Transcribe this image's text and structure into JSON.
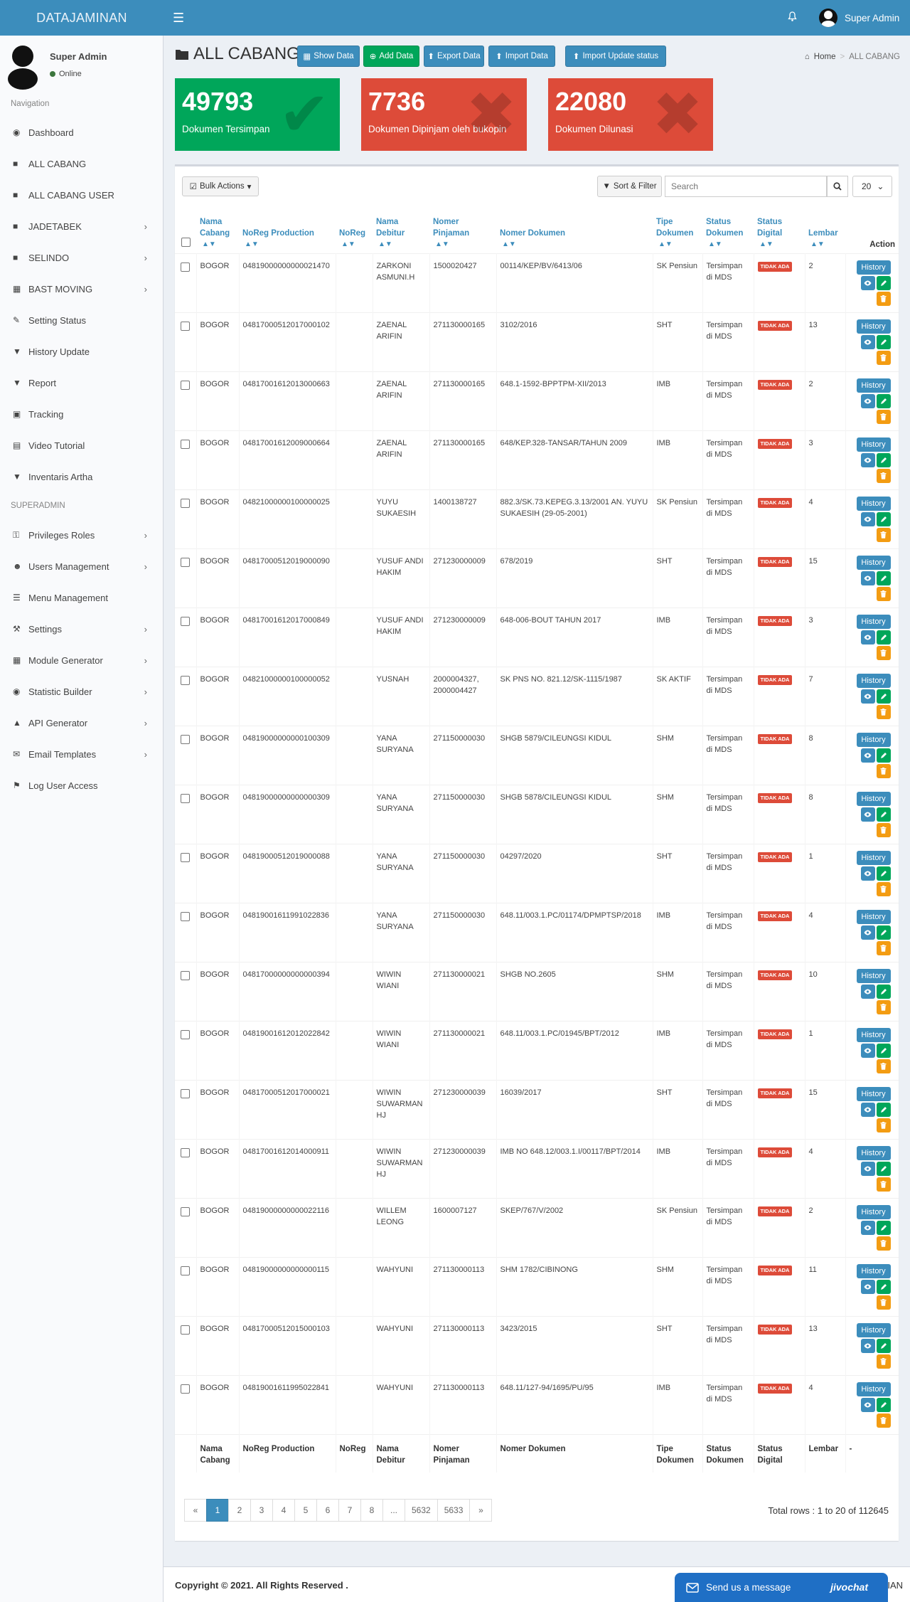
{
  "app": {
    "brand": "DATAJAMINAN",
    "top_user": "Super Admin"
  },
  "user_panel": {
    "name": "Super Admin",
    "status": "Online"
  },
  "sidebar": {
    "nav_header": "Navigation",
    "items": [
      {
        "label": "Dashboard",
        "icon": "dashboard-icon",
        "chev": false
      },
      {
        "label": "ALL CABANG",
        "icon": "folder-icon",
        "chev": false
      },
      {
        "label": "ALL CABANG USER",
        "icon": "folder-icon",
        "chev": false
      },
      {
        "label": "JADETABEK",
        "icon": "folder-icon",
        "chev": true
      },
      {
        "label": "SELINDO",
        "icon": "folder-icon",
        "chev": true
      },
      {
        "label": "BAST MOVING",
        "icon": "grid-icon",
        "chev": true
      },
      {
        "label": "Setting Status",
        "icon": "edit-icon",
        "chev": false
      },
      {
        "label": "History Update",
        "icon": "filter-icon",
        "chev": false
      },
      {
        "label": "Report",
        "icon": "filter-icon",
        "chev": false
      },
      {
        "label": "Tracking",
        "icon": "car-icon",
        "chev": false
      },
      {
        "label": "Video Tutorial",
        "icon": "file-icon",
        "chev": false
      },
      {
        "label": "Inventaris Artha",
        "icon": "filter-icon",
        "chev": false
      }
    ],
    "admin_header": "SUPERADMIN",
    "admin_items": [
      {
        "label": "Privileges Roles",
        "icon": "key-icon",
        "chev": true
      },
      {
        "label": "Users Management",
        "icon": "users-icon",
        "chev": true
      },
      {
        "label": "Menu Management",
        "icon": "menu-icon",
        "chev": false
      },
      {
        "label": "Settings",
        "icon": "wrench-icon",
        "chev": true
      },
      {
        "label": "Module Generator",
        "icon": "grid-icon",
        "chev": true
      },
      {
        "label": "Statistic Builder",
        "icon": "dashboard-icon",
        "chev": true
      },
      {
        "label": "API Generator",
        "icon": "flask-icon",
        "chev": true
      },
      {
        "label": "Email Templates",
        "icon": "envelope-icon",
        "chev": true
      },
      {
        "label": "Log User Access",
        "icon": "flag-icon",
        "chev": false
      }
    ]
  },
  "header": {
    "title": "ALL CABANG",
    "buttons": {
      "show": "Show Data",
      "add": "Add Data",
      "export": "Export Data",
      "import": "Import Data",
      "import_update": "Import Update status"
    },
    "breadcrumb": {
      "home": "Home",
      "current": "ALL CABANG"
    }
  },
  "stats": [
    {
      "value": "49793",
      "label": "Dokumen Tersimpan",
      "color": "#00a65a"
    },
    {
      "value": "7736",
      "label": "Dokumen Dipinjam oleh bukopin",
      "color": "#dd4b39"
    },
    {
      "value": "22080",
      "label": "Dokumen Dilunasi",
      "color": "#dd4b39"
    }
  ],
  "toolbar": {
    "bulk": "Bulk Actions",
    "sort": "Sort & Filter",
    "search_placeholder": "Search",
    "per_page": "20"
  },
  "table": {
    "headers": [
      "Nama Cabang",
      "NoReg Production",
      "NoReg",
      "Nama Debitur",
      "Nomer Pinjaman",
      "Nomer Dokumen",
      "Tipe Dokumen",
      "Status Dokumen",
      "Status Digital",
      "Lembar",
      "Action"
    ],
    "footer": [
      "Nama Cabang",
      "NoReg Production",
      "NoReg",
      "Nama Debitur",
      "Nomer Pinjaman",
      "Nomer Dokumen",
      "Tipe Dokumen",
      "Status Dokumen",
      "Status Digital",
      "Lembar",
      "-"
    ],
    "badge": "TIDAK ADA",
    "history_label": "History",
    "rows": [
      [
        "BOGOR",
        "04819000000000021470",
        "",
        "ZARKONI ASMUNI.H",
        "1500020427",
        "00114/KEP/BV/6413/06",
        "SK Pensiun",
        "Tersimpan di MDS",
        "2"
      ],
      [
        "BOGOR",
        "04817000512017000102",
        "",
        "ZAENAL ARIFIN",
        "271130000165",
        "3102/2016",
        "SHT",
        "Tersimpan di MDS",
        "13"
      ],
      [
        "BOGOR",
        "04817001612013000663",
        "",
        "ZAENAL ARIFIN",
        "271130000165",
        "648.1-1592-BPPTPM-XII/2013",
        "IMB",
        "Tersimpan di MDS",
        "2"
      ],
      [
        "BOGOR",
        "04817001612009000664",
        "",
        "ZAENAL ARIFIN",
        "271130000165",
        "648/KEP.328-TANSAR/TAHUN 2009",
        "IMB",
        "Tersimpan di MDS",
        "3"
      ],
      [
        "BOGOR",
        "04821000000100000025",
        "",
        "YUYU SUKAESIH",
        "1400138727",
        "882.3/SK.73.KEPEG.3.13/2001 AN. YUYU SUKAESIH (29-05-2001)",
        "SK Pensiun",
        "Tersimpan di MDS",
        "4"
      ],
      [
        "BOGOR",
        "04817000512019000090",
        "",
        "YUSUF ANDI HAKIM",
        "271230000009",
        "678/2019",
        "SHT",
        "Tersimpan di MDS",
        "15"
      ],
      [
        "BOGOR",
        "04817001612017000849",
        "",
        "YUSUF ANDI HAKIM",
        "271230000009",
        "648-006-BOUT TAHUN 2017",
        "IMB",
        "Tersimpan di MDS",
        "3"
      ],
      [
        "BOGOR",
        "04821000000100000052",
        "",
        "YUSNAH",
        "2000004327, 2000004427",
        "SK PNS NO. 821.12/SK-1115/1987",
        "SK AKTIF",
        "Tersimpan di MDS",
        "7"
      ],
      [
        "BOGOR",
        "04819000000000100309",
        "",
        "YANA SURYANA",
        "271150000030",
        "SHGB 5879/CILEUNGSI KIDUL",
        "SHM",
        "Tersimpan di MDS",
        "8"
      ],
      [
        "BOGOR",
        "04819000000000000309",
        "",
        "YANA SURYANA",
        "271150000030",
        "SHGB 5878/CILEUNGSI KIDUL",
        "SHM",
        "Tersimpan di MDS",
        "8"
      ],
      [
        "BOGOR",
        "04819000512019000088",
        "",
        "YANA SURYANA",
        "271150000030",
        "04297/2020",
        "SHT",
        "Tersimpan di MDS",
        "1"
      ],
      [
        "BOGOR",
        "04819001611991022836",
        "",
        "YANA SURYANA",
        "271150000030",
        "648.11/003.1.PC/01174/DPMPTSP/2018",
        "IMB",
        "Tersimpan di MDS",
        "4"
      ],
      [
        "BOGOR",
        "04817000000000000394",
        "",
        "WIWIN WIANI",
        "271130000021",
        "SHGB NO.2605",
        "SHM",
        "Tersimpan di MDS",
        "10"
      ],
      [
        "BOGOR",
        "04819001612012022842",
        "",
        "WIWIN WIANI",
        "271130000021",
        "648.11/003.1.PC/01945/BPT/2012",
        "IMB",
        "Tersimpan di MDS",
        "1"
      ],
      [
        "BOGOR",
        "04817000512017000021",
        "",
        "WIWIN SUWARMAN HJ",
        "271230000039",
        "16039/2017",
        "SHT",
        "Tersimpan di MDS",
        "15"
      ],
      [
        "BOGOR",
        "04817001612014000911",
        "",
        "WIWIN SUWARMAN HJ",
        "271230000039",
        "IMB NO 648.12/003.1.I/00117/BPT/2014",
        "IMB",
        "Tersimpan di MDS",
        "4"
      ],
      [
        "BOGOR",
        "04819000000000022116",
        "",
        "WILLEM LEONG",
        "1600007127",
        "SKEP/767/V/2002",
        "SK Pensiun",
        "Tersimpan di MDS",
        "2"
      ],
      [
        "BOGOR",
        "04819000000000000115",
        "",
        "WAHYUNI",
        "271130000113",
        "SHM 1782/CIBINONG",
        "SHM",
        "Tersimpan di MDS",
        "11"
      ],
      [
        "BOGOR",
        "04817000512015000103",
        "",
        "WAHYUNI",
        "271130000113",
        "3423/2015",
        "SHT",
        "Tersimpan di MDS",
        "13"
      ],
      [
        "BOGOR",
        "04819001611995022841",
        "",
        "WAHYUNI",
        "271130000113",
        "648.11/127-94/1695/PU/95",
        "IMB",
        "Tersimpan di MDS",
        "4"
      ]
    ]
  },
  "pagination": {
    "prev": "«",
    "pages": [
      "1",
      "2",
      "3",
      "4",
      "5",
      "6",
      "7",
      "8",
      "...",
      "5632",
      "5633"
    ],
    "next": "»",
    "active": "1",
    "total": "Total rows : 1 to 20 of 112645"
  },
  "footer": {
    "copyright": "Copyright © 2021. All Rights Reserved .",
    "right": "IAN"
  },
  "chat": {
    "label": "Send us a message",
    "brand": "jivochat"
  }
}
